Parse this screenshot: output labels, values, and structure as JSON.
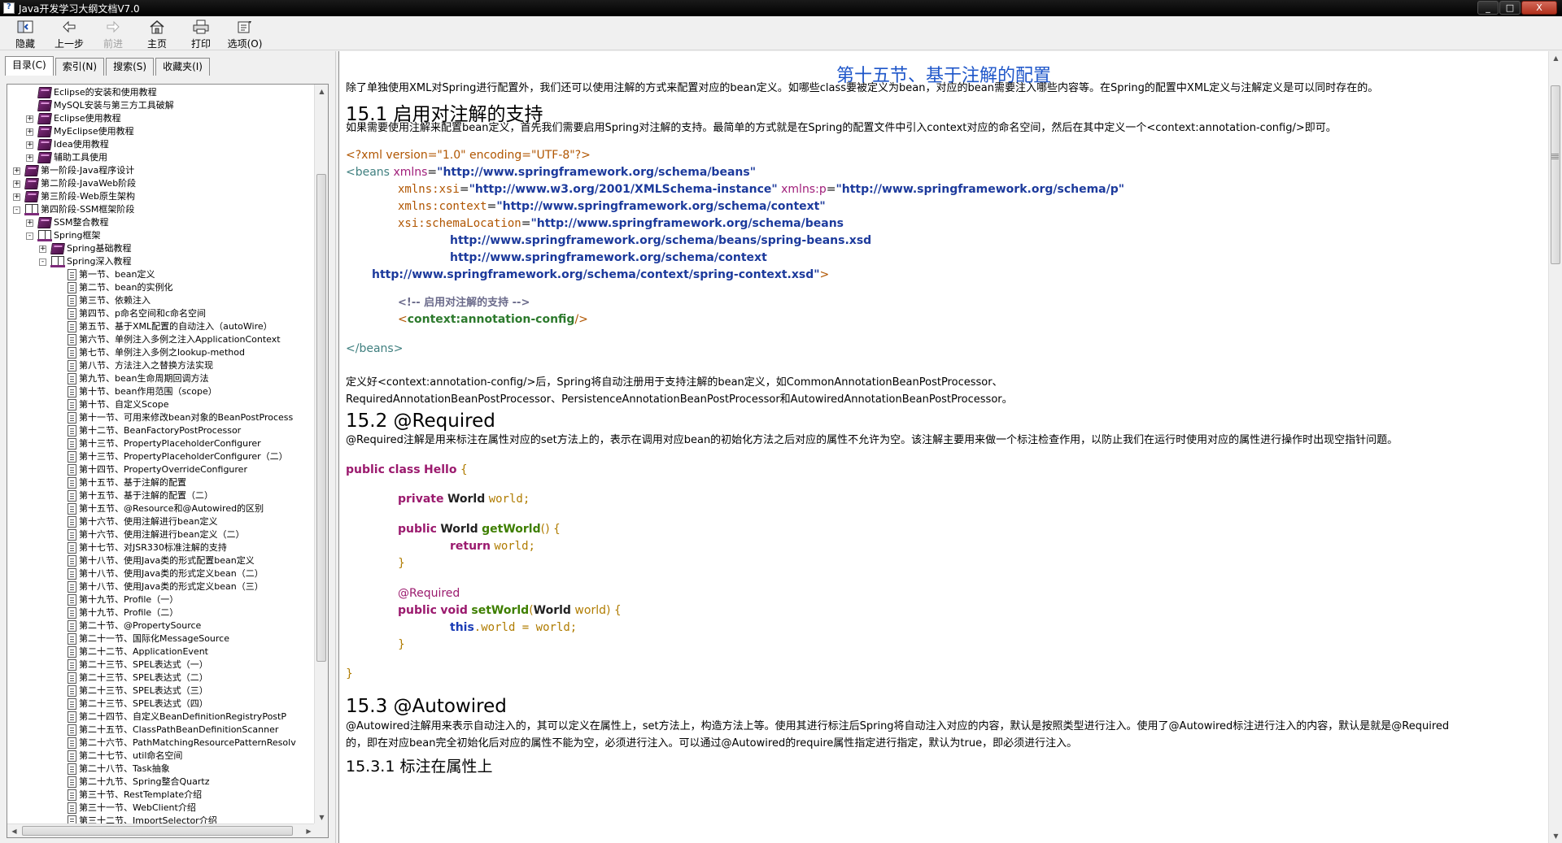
{
  "window": {
    "title": "Java开发学习大纲文档V7.0",
    "buttons": [
      "_",
      "□",
      "X"
    ]
  },
  "toolbar": {
    "hide": "隐藏",
    "back": "上一步",
    "forward": "前进",
    "home": "主页",
    "print": "打印",
    "options": "选项(O)"
  },
  "tabs": [
    "目录(C)",
    "索引(N)",
    "搜索(S)",
    "收藏夹(I)"
  ],
  "tree": [
    {
      "label": "Eclipse的安装和使用教程",
      "level": 1,
      "icon": "book",
      "exp": ""
    },
    {
      "label": "MySQL安装与第三方工具破解",
      "level": 1,
      "icon": "book",
      "exp": ""
    },
    {
      "label": "Eclipse使用教程",
      "level": 1,
      "icon": "book",
      "exp": "+"
    },
    {
      "label": "MyEclipse使用教程",
      "level": 1,
      "icon": "book",
      "exp": "+"
    },
    {
      "label": "Idea使用教程",
      "level": 1,
      "icon": "book",
      "exp": "+"
    },
    {
      "label": "辅助工具使用",
      "level": 1,
      "icon": "book",
      "exp": "+"
    },
    {
      "label": "第一阶段-Java程序设计",
      "level": 0,
      "icon": "book",
      "exp": "+"
    },
    {
      "label": "第二阶段-JavaWeb阶段",
      "level": 0,
      "icon": "book",
      "exp": "+"
    },
    {
      "label": "第三阶段-Web原生架构",
      "level": 0,
      "icon": "book",
      "exp": "+"
    },
    {
      "label": "第四阶段-SSM框架阶段",
      "level": 0,
      "icon": "openbook",
      "exp": "-"
    },
    {
      "label": "SSM整合教程",
      "level": 1,
      "icon": "book",
      "exp": "+"
    },
    {
      "label": "Spring框架",
      "level": 1,
      "icon": "openbook",
      "exp": "-"
    },
    {
      "label": "Spring基础教程",
      "level": 2,
      "icon": "book",
      "exp": "+"
    },
    {
      "label": "Spring深入教程",
      "level": 2,
      "icon": "openbook",
      "exp": "-"
    },
    {
      "label": "第一节、bean定义",
      "level": 3,
      "icon": "page",
      "exp": ""
    },
    {
      "label": "第二节、bean的实例化",
      "level": 3,
      "icon": "page",
      "exp": ""
    },
    {
      "label": "第三节、依赖注入",
      "level": 3,
      "icon": "page",
      "exp": ""
    },
    {
      "label": "第四节、p命名空间和c命名空间",
      "level": 3,
      "icon": "page",
      "exp": ""
    },
    {
      "label": "第五节、基于XML配置的自动注入（autoWire）",
      "level": 3,
      "icon": "page",
      "exp": ""
    },
    {
      "label": "第六节、单例注入多例之注入ApplicationContext",
      "level": 3,
      "icon": "page",
      "exp": ""
    },
    {
      "label": "第七节、单例注入多例之lookup-method",
      "level": 3,
      "icon": "page",
      "exp": ""
    },
    {
      "label": "第八节、方法注入之替换方法实现",
      "level": 3,
      "icon": "page",
      "exp": ""
    },
    {
      "label": "第九节、bean生命周期回调方法",
      "level": 3,
      "icon": "page",
      "exp": ""
    },
    {
      "label": "第十节、bean作用范围（scope）",
      "level": 3,
      "icon": "page",
      "exp": ""
    },
    {
      "label": "第十节、自定义Scope",
      "level": 3,
      "icon": "page",
      "exp": ""
    },
    {
      "label": "第十一节、可用来修改bean对象的BeanPostProcess",
      "level": 3,
      "icon": "page",
      "exp": ""
    },
    {
      "label": "第十二节、BeanFactoryPostProcessor",
      "level": 3,
      "icon": "page",
      "exp": ""
    },
    {
      "label": "第十三节、PropertyPlaceholderConfigurer",
      "level": 3,
      "icon": "page",
      "exp": ""
    },
    {
      "label": "第十三节、PropertyPlaceholderConfigurer（二）",
      "level": 3,
      "icon": "page",
      "exp": ""
    },
    {
      "label": "第十四节、PropertyOverrideConfigurer",
      "level": 3,
      "icon": "page",
      "exp": ""
    },
    {
      "label": "第十五节、基于注解的配置",
      "level": 3,
      "icon": "page",
      "exp": "",
      "selected": true
    },
    {
      "label": "第十五节、基于注解的配置（二）",
      "level": 3,
      "icon": "page",
      "exp": ""
    },
    {
      "label": "第十五节、@Resource和@Autowired的区别",
      "level": 3,
      "icon": "page",
      "exp": ""
    },
    {
      "label": "第十六节、使用注解进行bean定义",
      "level": 3,
      "icon": "page",
      "exp": ""
    },
    {
      "label": "第十六节、使用注解进行bean定义（二）",
      "level": 3,
      "icon": "page",
      "exp": ""
    },
    {
      "label": "第十七节、对JSR330标准注解的支持",
      "level": 3,
      "icon": "page",
      "exp": ""
    },
    {
      "label": "第十八节、使用Java类的形式配置bean定义",
      "level": 3,
      "icon": "page",
      "exp": ""
    },
    {
      "label": "第十八节、使用Java类的形式定义bean（二）",
      "level": 3,
      "icon": "page",
      "exp": ""
    },
    {
      "label": "第十八节、使用Java类的形式定义bean（三）",
      "level": 3,
      "icon": "page",
      "exp": ""
    },
    {
      "label": "第十九节、Profile（一）",
      "level": 3,
      "icon": "page",
      "exp": ""
    },
    {
      "label": "第十九节、Profile（二）",
      "level": 3,
      "icon": "page",
      "exp": ""
    },
    {
      "label": "第二十节、@PropertySource",
      "level": 3,
      "icon": "page",
      "exp": ""
    },
    {
      "label": "第二十一节、国际化MessageSource",
      "level": 3,
      "icon": "page",
      "exp": ""
    },
    {
      "label": "第二十二节、ApplicationEvent",
      "level": 3,
      "icon": "page",
      "exp": ""
    },
    {
      "label": "第二十三节、SPEL表达式（一）",
      "level": 3,
      "icon": "page",
      "exp": ""
    },
    {
      "label": "第二十三节、SPEL表达式（二）",
      "level": 3,
      "icon": "page",
      "exp": ""
    },
    {
      "label": "第二十三节、SPEL表达式（三）",
      "level": 3,
      "icon": "page",
      "exp": ""
    },
    {
      "label": "第二十三节、SPEL表达式（四）",
      "level": 3,
      "icon": "page",
      "exp": ""
    },
    {
      "label": "第二十四节、自定义BeanDefinitionRegistryPostP",
      "level": 3,
      "icon": "page",
      "exp": ""
    },
    {
      "label": "第二十五节、ClassPathBeanDefinitionScanner",
      "level": 3,
      "icon": "page",
      "exp": ""
    },
    {
      "label": "第二十六节、PathMatchingResourcePatternResolv",
      "level": 3,
      "icon": "page",
      "exp": ""
    },
    {
      "label": "第二十七节、util命名空间",
      "level": 3,
      "icon": "page",
      "exp": ""
    },
    {
      "label": "第二十八节、Task抽象",
      "level": 3,
      "icon": "page",
      "exp": ""
    },
    {
      "label": "第二十九节、Spring整合Quartz",
      "level": 3,
      "icon": "page",
      "exp": ""
    },
    {
      "label": "第三十节、RestTemplate介绍",
      "level": 3,
      "icon": "page",
      "exp": ""
    },
    {
      "label": "第三十一节、WebClient介绍",
      "level": 3,
      "icon": "page",
      "exp": ""
    },
    {
      "label": "第三十二节、ImportSelector介绍",
      "level": 3,
      "icon": "page",
      "exp": ""
    }
  ],
  "content": {
    "title": "第十五节、基于注解的配置",
    "intro": "除了单独使用XML对Spring进行配置外，我们还可以使用注解的方式来配置对应的bean定义。如哪些class要被定义为bean，对应的bean需要注入哪些内容等。在Spring的配置中XML定义与注解定义是可以同时存在的。",
    "h_15_1": "15.1 启用对注解的支持",
    "p_15_1": "如果需要使用注解来配置bean定义，首先我们需要启用Spring对注解的支持。最简单的方式就是在Spring的配置文件中引入context对应的命名空间，然后在其中定义一个<context:annotation-config/>即可。",
    "xml": {
      "decl": "<?xml version=\"1.0\" encoding=\"UTF-8\"?>",
      "beans_open": "<beans",
      "xmlns_attr": "xmlns",
      "xmlns_val": "\"http://www.springframework.org/schema/beans\"",
      "xsi_attr": "xmlns:xsi",
      "xsi_val": "\"http://www.w3.org/2001/XMLSchema-instance\"",
      "p_attr": "xmlns:p",
      "p_val": "\"http://www.springframework.org/schema/p\"",
      "ctx_attr": "xmlns:context",
      "ctx_val": "\"http://www.springframework.org/schema/context\"",
      "sl_attr": "xsi:schemaLocation",
      "sl_val1": "\"http://www.springframework.org/schema/beans",
      "sl_val2": "http://www.springframework.org/schema/beans/spring-beans.xsd",
      "sl_val3": "http://www.springframework.org/schema/context",
      "sl_val4": "http://www.springframework.org/schema/context/spring-context.xsd\"",
      "close_gt": ">",
      "comment": "<!-- 启用对注解的支持 -->",
      "annot_lt": "<",
      "annot_name": "context:annotation-config",
      "annot_gt": "/>",
      "beans_close": "</beans>"
    },
    "p_after_xml_1": "定义好<context:annotation-config/>后，Spring将自动注册用于支持注解的bean定义，如CommonAnnotationBeanPostProcessor、",
    "p_after_xml_2": "RequiredAnnotationBeanPostProcessor、PersistenceAnnotationBeanPostProcessor和AutowiredAnnotationBeanPostProcessor。",
    "h_15_2": "15.2 @Required",
    "p_15_2": "@Required注解是用来标注在属性对应的set方法上的，表示在调用对应bean的初始化方法之后对应的属性不允许为空。该注解主要用来做一个标注检查作用，以防止我们在运行时使用对应的属性进行操作时出现空指针问题。",
    "java": {
      "kw_public": "public",
      "kw_class": "class",
      "cls_hello": "Hello",
      "brace_open": "{",
      "kw_private": "private",
      "ty_world": "World",
      "fld_world": "world;",
      "m_getWorld": "getWorld",
      "paren_open_close": "() {",
      "kw_return": "return",
      "ret_val": "world;",
      "brace_close": "}",
      "ann_required": "@Required",
      "kw_void": "void",
      "m_setWorld": "setWorld",
      "param_open": "(",
      "param_name": "world",
      "param_close": ") {",
      "kw_this": "this",
      "assign": ".world = world;"
    },
    "h_15_3": "15.3 @Autowired",
    "p_15_3_1": "@Autowired注解用来表示自动注入的，其可以定义在属性上，set方法上，构造方法上等。使用其进行标注后Spring将自动注入对应的内容，默认是按照类型进行注入。使用了@Autowired标注进行注入的内容，默认是就是@Required",
    "p_15_3_2": "的，即在对应bean完全初始化后对应的属性不能为空，必须进行注入。可以通过@Autowired的require属性指定进行指定，默认为true，即必须进行注入。",
    "h_15_3_1": "15.3.1 标注在属性上"
  },
  "colors": {
    "title_blue": "#1e56c9",
    "xml_tag": "#3f7f7f",
    "xml_attr": "#b05500",
    "xml_value": "#1c3a9c",
    "java_keyword": "#9b1a6e"
  }
}
